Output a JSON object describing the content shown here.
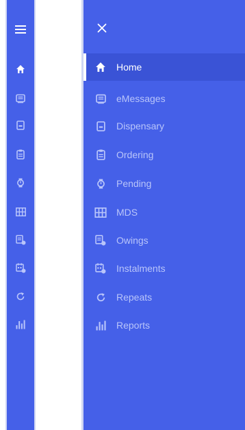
{
  "colors": {
    "background": "#4560e8",
    "active_bg": "#3a53d6",
    "inactive_text": "#b9c5fa",
    "active_text": "#ffffff",
    "border": "#cfd6f3"
  },
  "rail": {
    "menu_icon": "hamburger-icon",
    "items": [
      {
        "icon": "home-icon",
        "active": true
      },
      {
        "icon": "emessages-icon"
      },
      {
        "icon": "dispensary-icon"
      },
      {
        "icon": "ordering-icon"
      },
      {
        "icon": "pending-icon"
      },
      {
        "icon": "mds-icon"
      },
      {
        "icon": "owings-icon"
      },
      {
        "icon": "instalments-icon"
      },
      {
        "icon": "repeats-icon"
      },
      {
        "icon": "reports-icon"
      }
    ]
  },
  "drawer": {
    "close_icon": "close-icon",
    "items": [
      {
        "label": "Home",
        "icon": "home-icon",
        "active": true
      },
      {
        "label": "eMessages",
        "icon": "emessages-icon"
      },
      {
        "label": "Dispensary",
        "icon": "dispensary-icon"
      },
      {
        "label": "Ordering",
        "icon": "ordering-icon"
      },
      {
        "label": "Pending",
        "icon": "pending-icon"
      },
      {
        "label": "MDS",
        "icon": "mds-icon"
      },
      {
        "label": "Owings",
        "icon": "owings-icon"
      },
      {
        "label": "Instalments",
        "icon": "instalments-icon"
      },
      {
        "label": "Repeats",
        "icon": "repeats-icon"
      },
      {
        "label": "Reports",
        "icon": "reports-icon"
      }
    ]
  }
}
